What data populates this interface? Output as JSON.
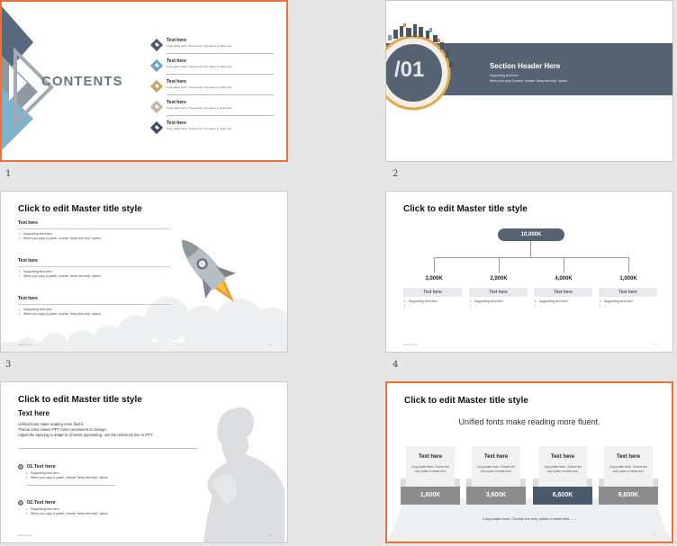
{
  "slides": [
    {
      "number": "1",
      "title": "CONTENTS",
      "items": [
        {
          "title": "Text here",
          "desc": "Copy paste fonts. Choose the only option to retain text.",
          "color": "#4a5a6c"
        },
        {
          "title": "Text here",
          "desc": "Copy paste fonts. Choose the only option to retain text.",
          "color": "#69a8c4"
        },
        {
          "title": "Text here",
          "desc": "Copy paste fonts. Choose the only option to retain text.",
          "color": "#c9a56c"
        },
        {
          "title": "Text here",
          "desc": "Copy paste fonts. Choose the only option to retain text.",
          "color": "#c1b6a6"
        },
        {
          "title": "Text here",
          "desc": "Copy paste fonts. Choose the only option to retain text.",
          "color": "#3f4e5f"
        }
      ]
    },
    {
      "number": "2",
      "section_num": "/01",
      "header": "Section Header Here",
      "sub1": "Supporting text here.",
      "sub2": "When you copy & paste, choose \"keep text only\" option."
    },
    {
      "number": "3",
      "title": "Click to edit Master title style",
      "blocks": [
        {
          "heading": "Text here",
          "b1": "Supporting text here.",
          "b2": "When you copy & paste, choose \"keep text only\" option."
        },
        {
          "heading": "Text here",
          "b1": "Supporting text here.",
          "b2": "When you copy & paste, choose \"keep text only\" option."
        },
        {
          "heading": "Text here",
          "b1": "Supporting text here.",
          "b2": "When you copy & paste, choose \"keep text only\" option."
        }
      ],
      "footer": "www.xxx.xx",
      "page": "3"
    },
    {
      "number": "4",
      "title": "Click to edit Master title style",
      "root": "10,000K",
      "children": [
        {
          "value": "3,000K",
          "label": "Text here",
          "b1": "Supporting text here.",
          "b2": "..."
        },
        {
          "value": "2,000K",
          "label": "Text here",
          "b1": "Supporting text here.",
          "b2": "..."
        },
        {
          "value": "4,000K",
          "label": "Text here",
          "b1": "Supporting text here.",
          "b2": "..."
        },
        {
          "value": "1,000K",
          "label": "Text here",
          "b1": "Supporting text here.",
          "b2": "..."
        }
      ],
      "footer": "www.xxx.xx",
      "page": "4"
    },
    {
      "number": "5",
      "title": "Click to edit Master title style",
      "subtitle": "Text here",
      "lines": [
        "Unified fonts make reading more fluent.",
        "Theme color makes PPT more convenient to change.",
        "Adjust the spacing to adapt to Chinese typesetting, use the reference line in PPT."
      ],
      "points": [
        {
          "heading": "01.Text here",
          "b1": "Supporting text here.",
          "b2": "When you copy & paste, choose \"keep text only\" option."
        },
        {
          "heading": "02.Text here",
          "b1": "Supporting text here.",
          "b2": "When you copy & paste, choose \"keep text only\" option."
        }
      ],
      "footer": "www.xxx.xx",
      "page": "5"
    },
    {
      "number": "6",
      "title": "Click to edit Master title style",
      "headline": "Unified fonts make reading more fluent.",
      "cards": [
        {
          "title": "Text here",
          "desc": "Copy paste fonts. Choose the only option to retain text.",
          "sep": "......",
          "value": "1,600K",
          "color": "#8c8c8c"
        },
        {
          "title": "Text here",
          "desc": "Copy paste fonts. Choose the only option to retain text.",
          "sep": "......",
          "value": "3,600K",
          "color": "#8c8c8c"
        },
        {
          "title": "Text here",
          "desc": "Copy paste fonts. Choose the only option to retain text.",
          "sep": "......",
          "value": "6,600K",
          "color": "#4b5a6b"
        },
        {
          "title": "Text here",
          "desc": "Copy paste fonts. Choose the only option to retain text.",
          "sep": "......",
          "value": "6,600K",
          "color": "#8c8c8c"
        }
      ],
      "bottom_note": "Copy paste fonts. Choose the only option to retain text.......",
      "page": "6"
    }
  ],
  "colors": {
    "selection": "#e8733d",
    "slate": "#566372",
    "accent_blue": "#6aa8c6"
  }
}
